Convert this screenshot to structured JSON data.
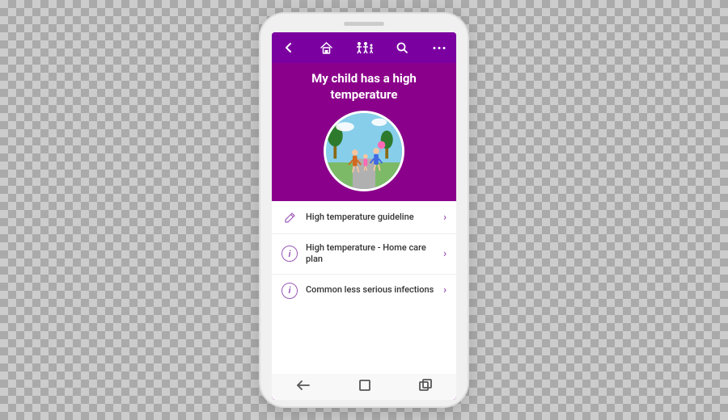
{
  "phone": {
    "header": {
      "title": "My child has a high temperature"
    },
    "nav": {
      "back_label": "‹",
      "home_label": "⌂",
      "people_label": "👥",
      "search_label": "🔍",
      "more_label": "···"
    },
    "menu_items": [
      {
        "id": "guideline",
        "icon_type": "pencil",
        "icon_label": "✏",
        "text": "High temperature guideline",
        "chevron": "›"
      },
      {
        "id": "home-care",
        "icon_type": "info",
        "icon_label": "i",
        "text": "High temperature - Home care plan",
        "chevron": "›"
      },
      {
        "id": "infections",
        "icon_type": "info",
        "icon_label": "i",
        "text": "Common less serious infections",
        "chevron": "›"
      }
    ],
    "bottom_nav": {
      "back": "◁",
      "home": "□",
      "recent": "▣"
    }
  }
}
